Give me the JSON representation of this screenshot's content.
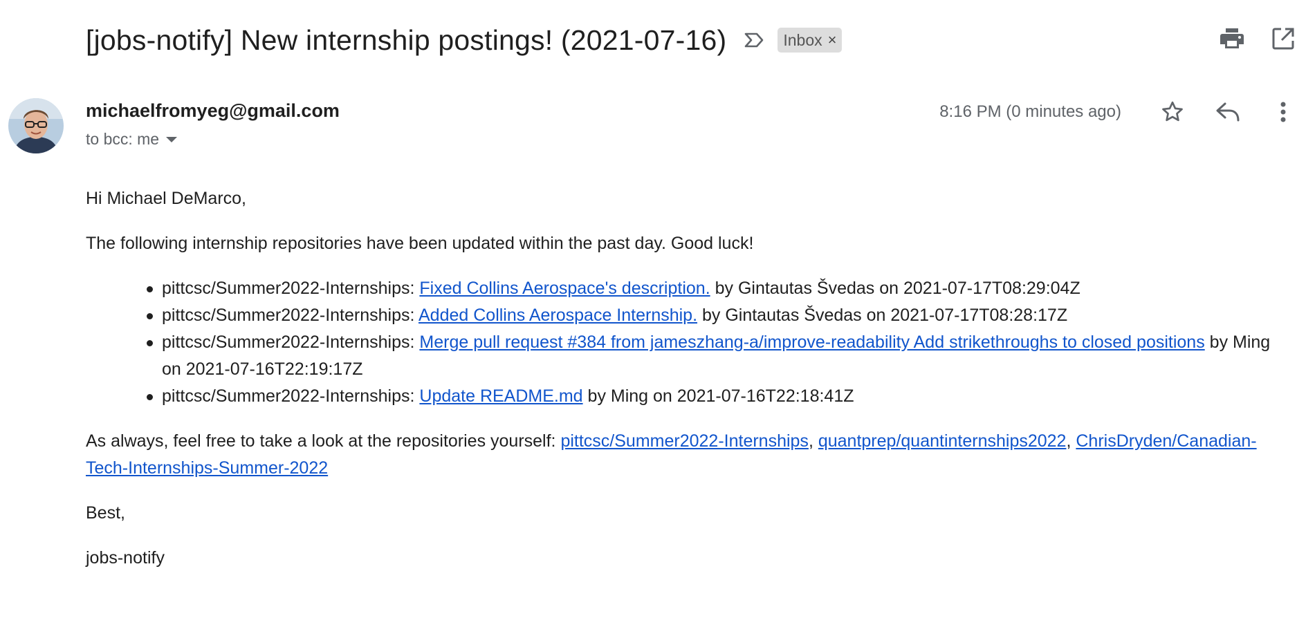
{
  "header": {
    "subject": "[jobs-notify] New internship postings! (2021-07-16)",
    "label": "Inbox",
    "label_remove": "×"
  },
  "message": {
    "sender": "michaelfromyeg@gmail.com",
    "recipients": "to bcc: me",
    "timestamp": "8:16 PM (0 minutes ago)"
  },
  "body": {
    "greeting": "Hi Michael DeMarco,",
    "intro": "The following internship repositories have been updated within the past day. Good luck!",
    "updates": [
      {
        "repo": "pittcsc/Summer2022-Internships: ",
        "link": "Fixed Collins Aerospace's description.",
        "tail": " by Gintautas Švedas on 2021-07-17T08:29:04Z"
      },
      {
        "repo": "pittcsc/Summer2022-Internships: ",
        "link": "Added Collins Aerospace Internship.",
        "tail": " by Gintautas Švedas on 2021-07-17T08:28:17Z"
      },
      {
        "repo": "pittcsc/Summer2022-Internships: ",
        "link": "Merge pull request #384 from jameszhang-a/improve-readability Add strikethroughs to closed positions",
        "tail": " by Ming on 2021-07-16T22:19:17Z"
      },
      {
        "repo": "pittcsc/Summer2022-Internships: ",
        "link": "Update README.md",
        "tail": " by Ming on 2021-07-16T22:18:41Z"
      }
    ],
    "outro_prefix": "As always, feel free to take a look at the repositories yourself: ",
    "repo_links": [
      "pittcsc/Summer2022-Internships",
      "quantprep/quantinternships2022",
      "ChrisDryden/Canadian-Tech-Internships-Summer-2022"
    ],
    "separator": ", ",
    "signoff": "Best,",
    "signature": "jobs-notify"
  },
  "icons": {
    "important": "important-marker-icon",
    "print": "print-icon",
    "open_new_window": "open-in-new-window-icon",
    "star": "star-icon",
    "reply": "reply-icon",
    "more": "more-vert-icon"
  },
  "colors": {
    "link": "#1155cc",
    "chip_bg": "#dddddd",
    "muted_text": "#5f6368"
  }
}
